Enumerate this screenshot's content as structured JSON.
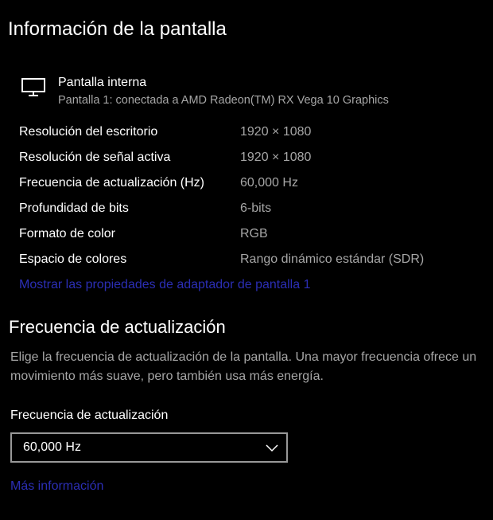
{
  "page": {
    "title": "Información de la pantalla"
  },
  "display": {
    "icon": "monitor-icon",
    "name": "Pantalla interna",
    "subtitle": "Pantalla 1: conectada a AMD Radeon(TM) RX Vega 10 Graphics"
  },
  "properties": [
    {
      "label": "Resolución del escritorio",
      "value": "1920 × 1080"
    },
    {
      "label": "Resolución de señal activa",
      "value": "1920 × 1080"
    },
    {
      "label": "Frecuencia de actualización (Hz)",
      "value": "60,000 Hz"
    },
    {
      "label": "Profundidad de bits",
      "value": "6-bits"
    },
    {
      "label": "Formato de color",
      "value": "RGB"
    },
    {
      "label": "Espacio de colores",
      "value": "Rango dinámico estándar (SDR)"
    }
  ],
  "adapter_link": "Mostrar las propiedades de adaptador de pantalla 1",
  "refresh_section": {
    "title": "Frecuencia de actualización",
    "description": "Elige la frecuencia de actualización de la pantalla. Una mayor frecuencia ofrece un movimiento más suave, pero también usa más energía.",
    "field_label": "Frecuencia de actualización",
    "selected_value": "60,000 Hz",
    "dropdown_icon": "chevron-down-icon"
  },
  "more_info_link": "Más información",
  "colors": {
    "background": "#000000",
    "text": "#ffffff",
    "secondary_text": "#a6a6a6",
    "link": "#2b2eb5",
    "dropdown_border": "#989898"
  }
}
